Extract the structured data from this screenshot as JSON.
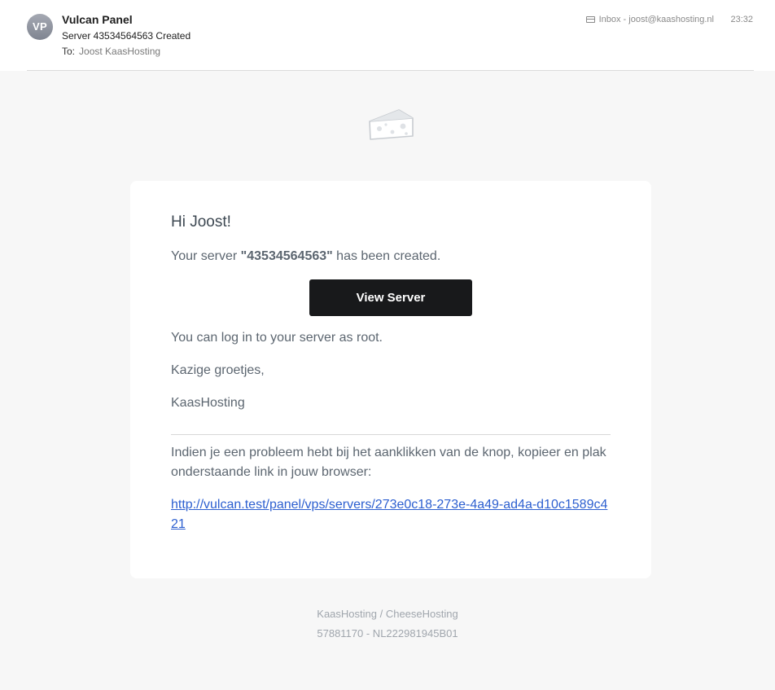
{
  "mail": {
    "avatar_initials": "VP",
    "sender": "Vulcan Panel",
    "subject": "Server 43534564563 Created",
    "to_label": "To:",
    "to_name": "Joost KaasHosting",
    "mailbox": "Inbox - joost@kaashosting.nl",
    "mailbox_icon": "tray-icon",
    "time": "23:32"
  },
  "email": {
    "logo_icon": "cheese-icon",
    "greeting": "Hi Joost!",
    "intro_prefix": "Your server ",
    "server_name": "\"43534564563\"",
    "intro_suffix": " has been created.",
    "button_label": "View Server",
    "line_root": "You can log in to your server as root.",
    "line_greeting": "Kazige groetjes,",
    "line_signature": "KaasHosting",
    "subcopy": "Indien je een probleem hebt bij het aanklikken van de knop, kopieer en plak onderstaande link in jouw browser:",
    "link": "http://vulcan.test/panel/vps/servers/273e0c18-273e-4a49-ad4a-d10c1589c421"
  },
  "footer": {
    "company": "KaasHosting / CheeseHosting",
    "registration": "57881170 - NL222981945B01"
  },
  "colors": {
    "button_bg": "#18191b",
    "link": "#2c5fd0",
    "page_bg": "#f7f7f7"
  }
}
